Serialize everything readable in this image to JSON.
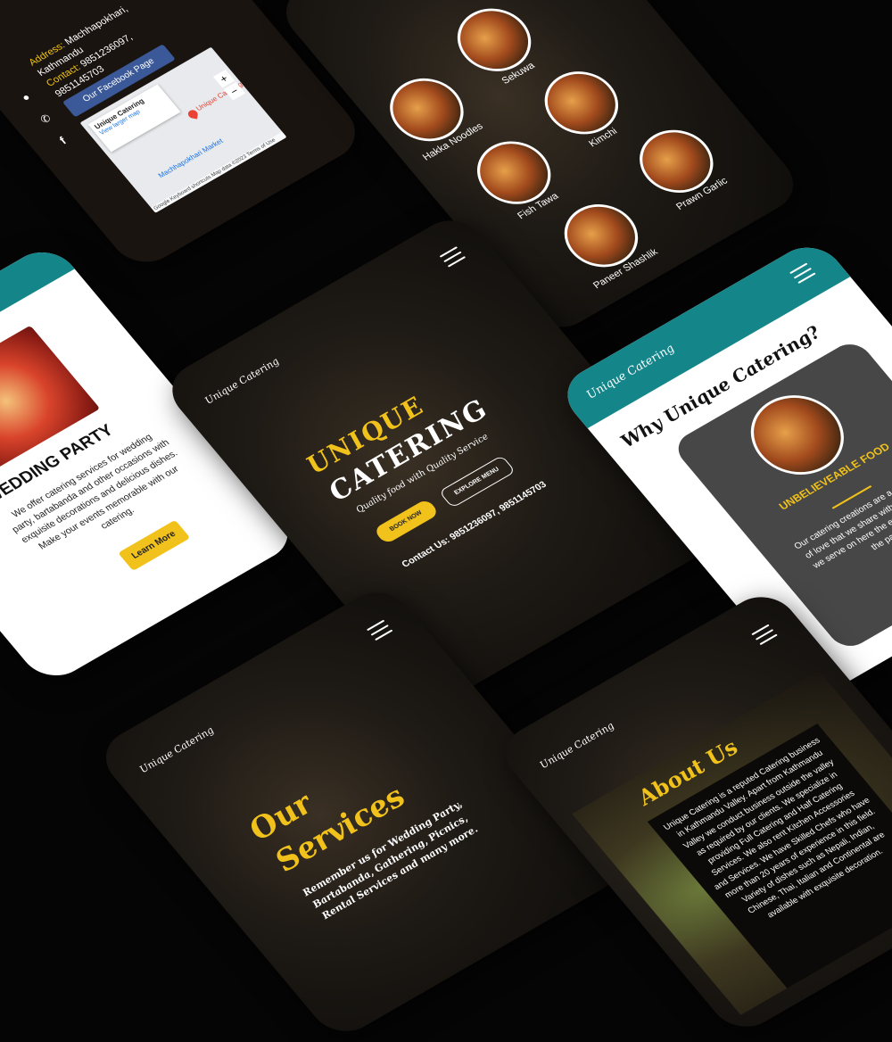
{
  "contact_phone": {
    "address_label": "Address:",
    "address_lines": [
      "Machhapokhari,",
      "Kathmandu"
    ],
    "contact_label": "Contact:",
    "contact_numbers": [
      "9851236097,",
      "9851145703"
    ],
    "facebook_button": "Our Facebook Page",
    "map": {
      "place_name": "Unique Catering",
      "view_larger": "View larger map",
      "pin_label": "Unique Catering",
      "market_label": "Machhapokhari Market",
      "footer_items": [
        "Keyboard shortcuts",
        "Map data ©2023",
        "Terms of Use"
      ],
      "brand": "Google"
    }
  },
  "menu_phone": {
    "dishes": [
      "Hakka Noodles",
      "Sekuwa",
      "Kimchi",
      "Fish Tawa",
      "Prawn Garlic",
      "Paneer Shashlik"
    ]
  },
  "wedding_phone": {
    "title": "WEDDING PARTY",
    "description": "We offer catering services for wedding party, bartabanda and other occasions with exquisite decorations and delicious dishes. Make your events memorable with our catering.",
    "button": "Learn More"
  },
  "hero_phone": {
    "logo": "Unique Catering",
    "title_line1": "UNIQUE",
    "title_line2": "CATERING",
    "tagline": "Quality food with Quality Service",
    "book_button": "BOOK NOW",
    "explore_button": "EXPLORE MENU",
    "contact": "Contact Us: 9851236097, 9851145703"
  },
  "why_phone": {
    "logo": "Unique Catering",
    "heading": "Why Unique Catering?",
    "card_title": "UNBELIEVEABLE FOOD",
    "card_text": "Our catering creations are a deep form of love that we share with people who we serve on here the extravaganza of the par..."
  },
  "services_phone": {
    "logo": "Unique Catering",
    "heading_line1": "Our",
    "heading_line2": "Services",
    "subtext": "Remember us for Wedding Party, Bartabanda, Gathering, Picnics, Rental Services and many more."
  },
  "about_phone": {
    "logo": "Unique Catering",
    "heading": "About Us",
    "text": "Unique Catering is a reputed Catering business in Kathmandu Valley. Apart from Kathmandu Valley we conduct business outside the valley as required by our clients. We specialize in providing Full Catering and Half Catering Services. We also rent Kitchen Accessories and Services. We have Skilled Chefs who have more than 20 years of experience in this field. Variety of dishes such as Nepali, Indian, Chinese, Thai, Italian and Continental are available with exquisite decoration."
  },
  "colors": {
    "accent": "#f1c21b",
    "teal": "#14868a",
    "dark": "#1e1a15"
  }
}
